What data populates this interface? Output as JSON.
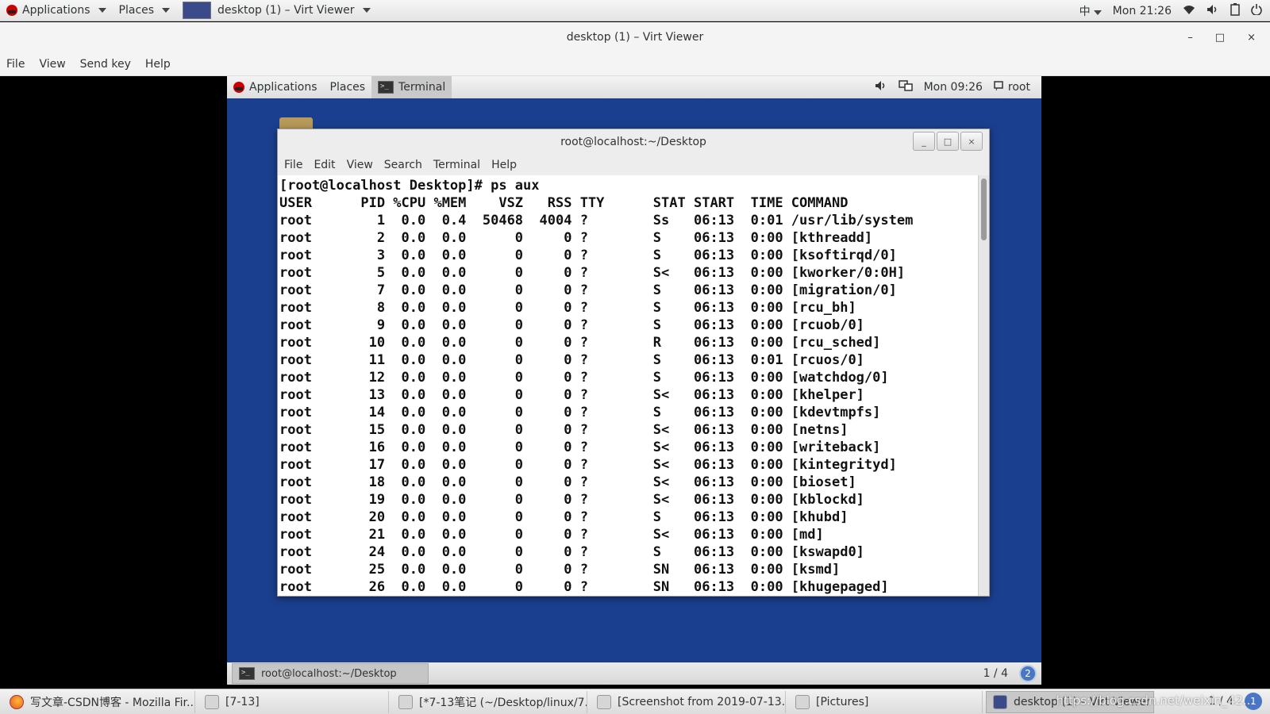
{
  "host_panel": {
    "applications": "Applications",
    "places": "Places",
    "window": "desktop (1) – Virt Viewer",
    "input_method": "中",
    "clock": "Mon 21:26"
  },
  "virt_viewer": {
    "title": "desktop (1) – Virt Viewer",
    "controls": {
      "minimize": "–",
      "maximize": "□",
      "close": "×"
    },
    "menu": [
      "File",
      "View",
      "Send key",
      "Help"
    ]
  },
  "guest_panel": {
    "applications": "Applications",
    "places": "Places",
    "terminal": "Terminal",
    "clock": "Mon 09:26",
    "user": "root"
  },
  "terminal": {
    "title": "root@localhost:~/Desktop",
    "controls": {
      "minimize": "_",
      "maximize": "□",
      "close": "×"
    },
    "menu": [
      "File",
      "Edit",
      "View",
      "Search",
      "Terminal",
      "Help"
    ],
    "prompt": "[root@localhost Desktop]# ps aux",
    "columns": [
      "USER",
      "PID",
      "%CPU",
      "%MEM",
      "VSZ",
      "RSS",
      "TTY",
      "STAT",
      "START",
      "TIME",
      "COMMAND"
    ],
    "rows": [
      [
        "root",
        "1",
        "0.0",
        "0.4",
        "50468",
        "4004",
        "?",
        "Ss",
        "06:13",
        "0:01",
        "/usr/lib/system"
      ],
      [
        "root",
        "2",
        "0.0",
        "0.0",
        "0",
        "0",
        "?",
        "S",
        "06:13",
        "0:00",
        "[kthreadd]"
      ],
      [
        "root",
        "3",
        "0.0",
        "0.0",
        "0",
        "0",
        "?",
        "S",
        "06:13",
        "0:00",
        "[ksoftirqd/0]"
      ],
      [
        "root",
        "5",
        "0.0",
        "0.0",
        "0",
        "0",
        "?",
        "S<",
        "06:13",
        "0:00",
        "[kworker/0:0H]"
      ],
      [
        "root",
        "7",
        "0.0",
        "0.0",
        "0",
        "0",
        "?",
        "S",
        "06:13",
        "0:00",
        "[migration/0]"
      ],
      [
        "root",
        "8",
        "0.0",
        "0.0",
        "0",
        "0",
        "?",
        "S",
        "06:13",
        "0:00",
        "[rcu_bh]"
      ],
      [
        "root",
        "9",
        "0.0",
        "0.0",
        "0",
        "0",
        "?",
        "S",
        "06:13",
        "0:00",
        "[rcuob/0]"
      ],
      [
        "root",
        "10",
        "0.0",
        "0.0",
        "0",
        "0",
        "?",
        "R",
        "06:13",
        "0:00",
        "[rcu_sched]"
      ],
      [
        "root",
        "11",
        "0.0",
        "0.0",
        "0",
        "0",
        "?",
        "S",
        "06:13",
        "0:01",
        "[rcuos/0]"
      ],
      [
        "root",
        "12",
        "0.0",
        "0.0",
        "0",
        "0",
        "?",
        "S",
        "06:13",
        "0:00",
        "[watchdog/0]"
      ],
      [
        "root",
        "13",
        "0.0",
        "0.0",
        "0",
        "0",
        "?",
        "S<",
        "06:13",
        "0:00",
        "[khelper]"
      ],
      [
        "root",
        "14",
        "0.0",
        "0.0",
        "0",
        "0",
        "?",
        "S",
        "06:13",
        "0:00",
        "[kdevtmpfs]"
      ],
      [
        "root",
        "15",
        "0.0",
        "0.0",
        "0",
        "0",
        "?",
        "S<",
        "06:13",
        "0:00",
        "[netns]"
      ],
      [
        "root",
        "16",
        "0.0",
        "0.0",
        "0",
        "0",
        "?",
        "S<",
        "06:13",
        "0:00",
        "[writeback]"
      ],
      [
        "root",
        "17",
        "0.0",
        "0.0",
        "0",
        "0",
        "?",
        "S<",
        "06:13",
        "0:00",
        "[kintegrityd]"
      ],
      [
        "root",
        "18",
        "0.0",
        "0.0",
        "0",
        "0",
        "?",
        "S<",
        "06:13",
        "0:00",
        "[bioset]"
      ],
      [
        "root",
        "19",
        "0.0",
        "0.0",
        "0",
        "0",
        "?",
        "S<",
        "06:13",
        "0:00",
        "[kblockd]"
      ],
      [
        "root",
        "20",
        "0.0",
        "0.0",
        "0",
        "0",
        "?",
        "S",
        "06:13",
        "0:00",
        "[khubd]"
      ],
      [
        "root",
        "21",
        "0.0",
        "0.0",
        "0",
        "0",
        "?",
        "S<",
        "06:13",
        "0:00",
        "[md]"
      ],
      [
        "root",
        "24",
        "0.0",
        "0.0",
        "0",
        "0",
        "?",
        "S",
        "06:13",
        "0:00",
        "[kswapd0]"
      ],
      [
        "root",
        "25",
        "0.0",
        "0.0",
        "0",
        "0",
        "?",
        "SN",
        "06:13",
        "0:00",
        "[ksmd]"
      ],
      [
        "root",
        "26",
        "0.0",
        "0.0",
        "0",
        "0",
        "?",
        "SN",
        "06:13",
        "0:00",
        "[khugepaged]"
      ]
    ]
  },
  "guest_bottom": {
    "task": "root@localhost:~/Desktop",
    "workspace": "1 / 4",
    "workspace_badge": "2"
  },
  "host_taskbar": {
    "tasks": [
      {
        "label": "写文章-CSDN博客 - Mozilla Fir...",
        "icon": "firefox-icon"
      },
      {
        "label": "[7-13]",
        "icon": "folder-icon"
      },
      {
        "label": "[*7-13笔记 (~/Desktop/linux/7...",
        "icon": "text-editor-icon"
      },
      {
        "label": "[Screenshot from 2019-07-13...",
        "icon": "image-viewer-icon"
      },
      {
        "label": "[Pictures]",
        "icon": "folder-icon"
      },
      {
        "label": "desktop (1) – Virt Viewer",
        "icon": "virt-viewer-icon"
      }
    ],
    "workspace": "1 / 4",
    "watermark": "https://blog.csdn.net/weixin_42..."
  }
}
